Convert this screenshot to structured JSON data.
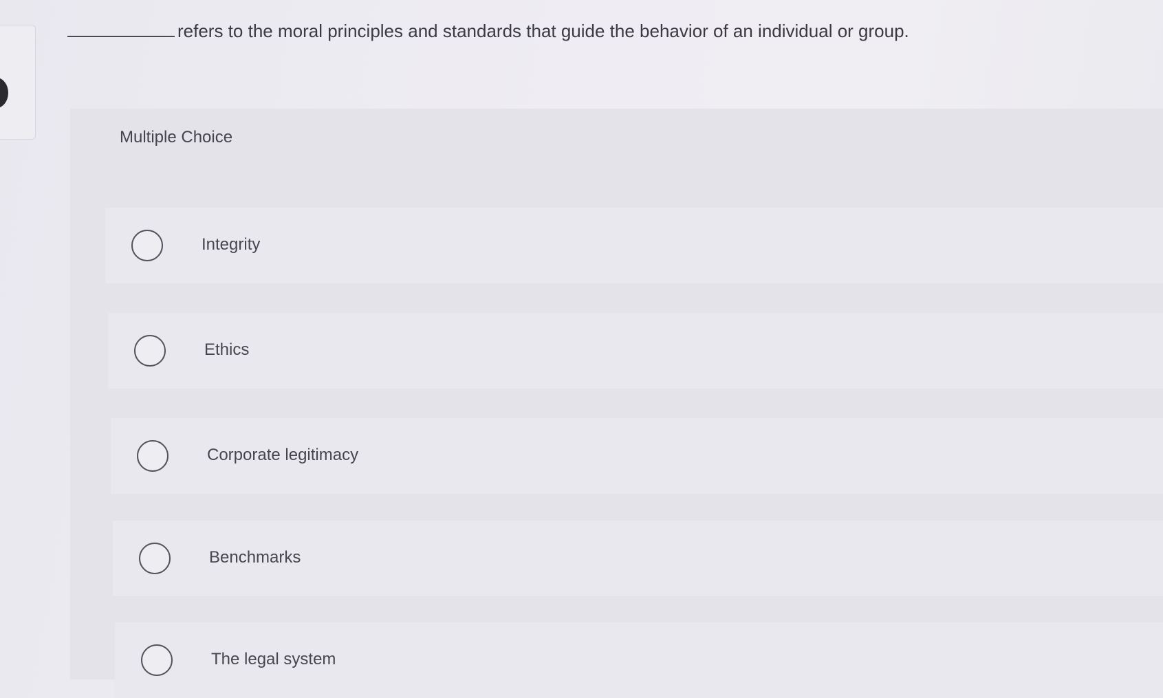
{
  "question": {
    "text": "refers to the moral principles and standards that guide the behavior of an individual or group."
  },
  "section": {
    "title": "Multiple Choice"
  },
  "options": [
    {
      "label": "Integrity"
    },
    {
      "label": "Ethics"
    },
    {
      "label": "Corporate legitimacy"
    },
    {
      "label": "Benchmarks"
    },
    {
      "label": "The legal system"
    }
  ]
}
